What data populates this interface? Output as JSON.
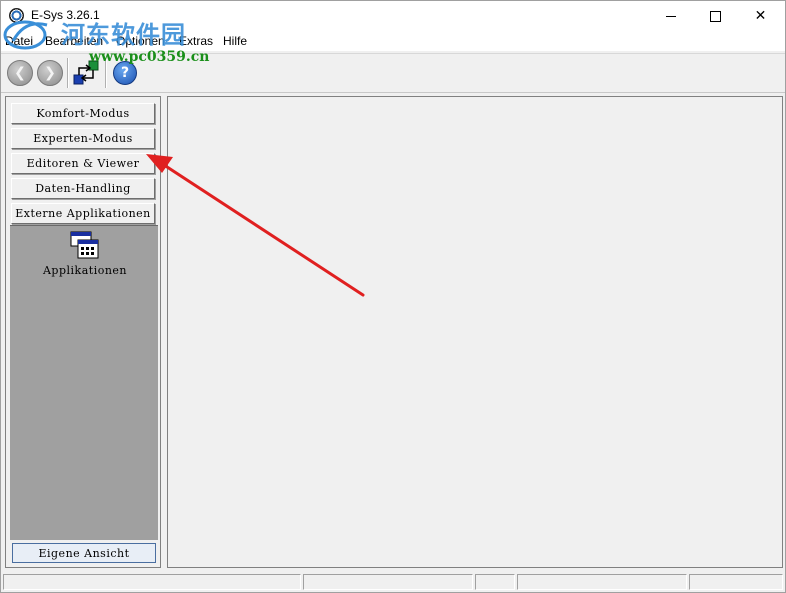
{
  "window": {
    "title": "E-Sys 3.26.1",
    "minimize_glyph": "",
    "maximize_glyph": "",
    "close_glyph": "✕"
  },
  "watermark": {
    "site_name_cn": "河东软件园",
    "url": "www.pc0359.cn"
  },
  "menubar": {
    "items": [
      {
        "label": "Datei"
      },
      {
        "label": "Bearbeiten"
      },
      {
        "label": "Optionen"
      },
      {
        "label": "Extras"
      },
      {
        "label": "Hilfe"
      }
    ]
  },
  "toolbar": {
    "back_icon": "back-arrow-icon",
    "forward_icon": "forward-arrow-icon",
    "transfer_icon": "connection-transfer-icon",
    "help_icon": "help-icon",
    "back_glyph": "❮",
    "forward_glyph": "❯",
    "help_glyph": "?"
  },
  "left_panel": {
    "nav_buttons": [
      {
        "label": "Komfort-Modus"
      },
      {
        "label": "Experten-Modus"
      },
      {
        "label": "Editoren & Viewer"
      },
      {
        "label": "Daten-Handling"
      },
      {
        "label": "Externe Applikationen"
      }
    ],
    "active_section": {
      "tile_label": "Applikationen",
      "tile_icon": "applications-window-icon"
    },
    "bottom_button": "Eigene Ansicht"
  },
  "colors": {
    "annotation_arrow": "#e02020",
    "watermark_text": "#3a8fd8",
    "watermark_url": "#1a8f1a",
    "nav_area_bg": "#a0a0a0"
  }
}
